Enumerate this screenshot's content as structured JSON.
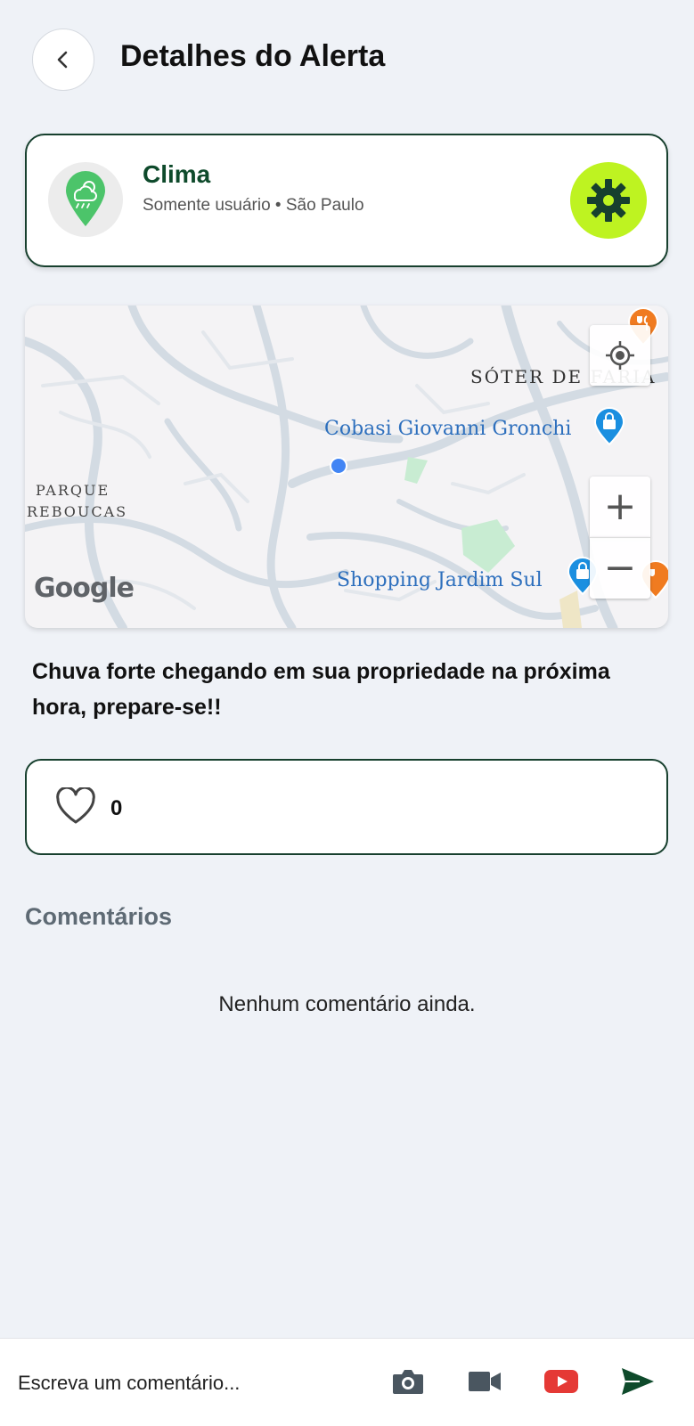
{
  "header": {
    "title": "Detalhes do Alerta"
  },
  "alert": {
    "title": "Clima",
    "subtitle": "Somente usuário • São Paulo"
  },
  "map": {
    "labels": {
      "district_top": "SÓTER DE FARIA",
      "poi_1": "Cobasi Giovanni Gronchi",
      "poi_2": "Shopping Jardim Sul",
      "area_line1": "PARQUE",
      "area_line2": "REBOUCAS"
    },
    "zoom_in": "+",
    "zoom_out": "−",
    "attribution": "Google"
  },
  "description": "Chuva forte chegando em sua propriedade na próxima hora, prepare-se!!",
  "likes": {
    "count": "0"
  },
  "comments": {
    "title": "Comentários",
    "empty_text": "Nenhum comentário ainda."
  },
  "composer": {
    "placeholder": "Escreva um comentário..."
  },
  "colors": {
    "brand_dark": "#17402e",
    "accent_lime": "#bef321",
    "youtube_red": "#e53935",
    "send_green": "#0e4a2b"
  }
}
